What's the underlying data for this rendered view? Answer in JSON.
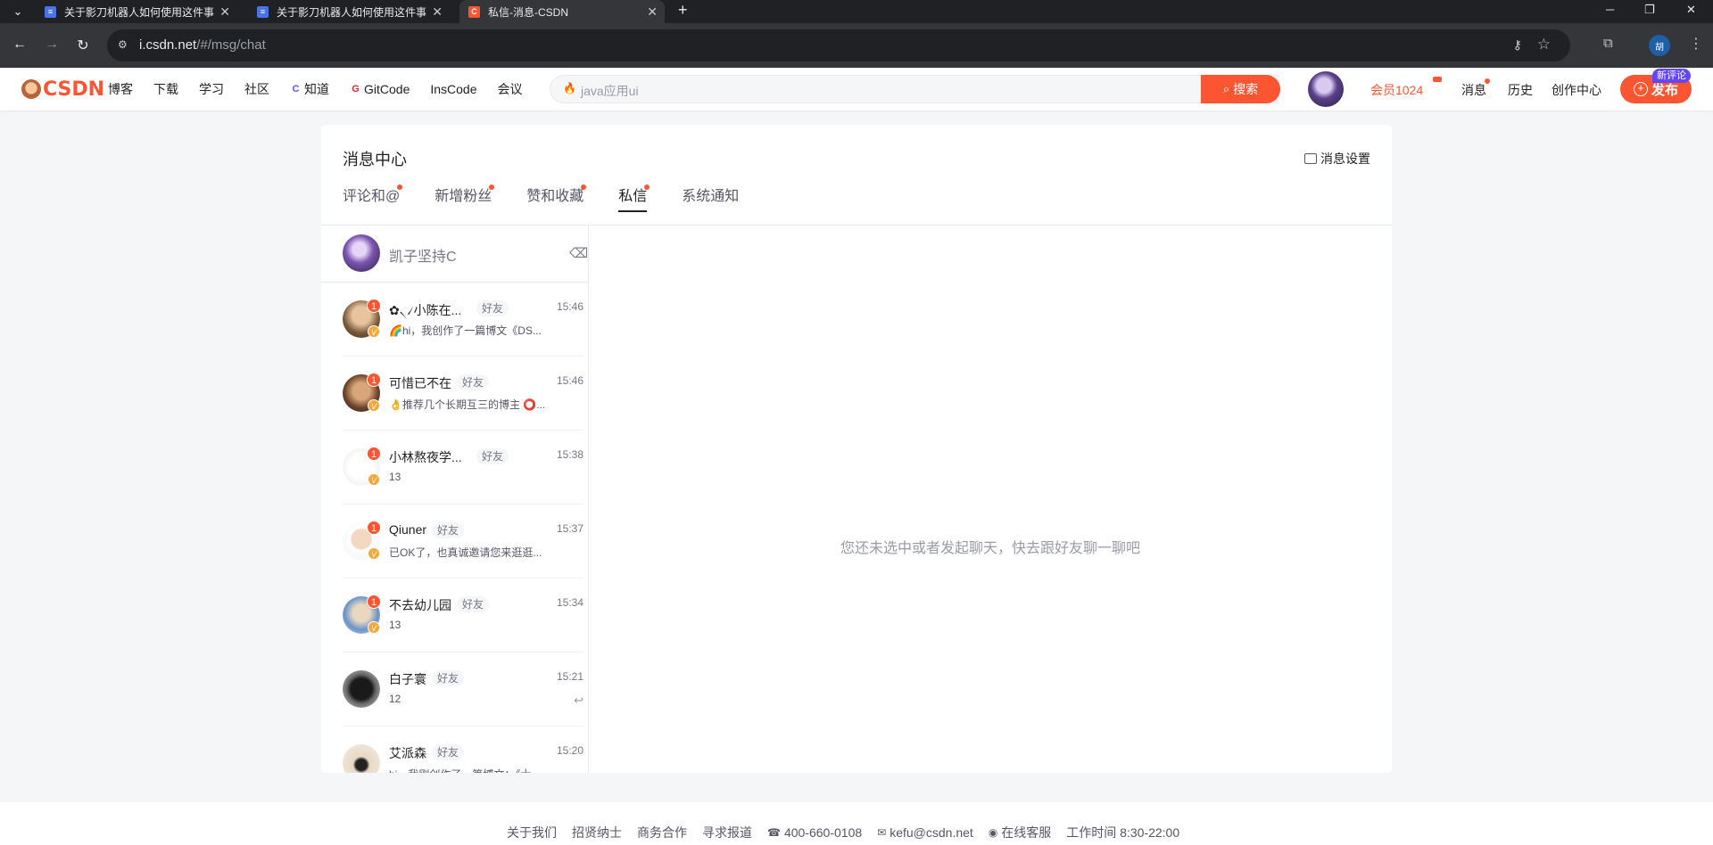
{
  "browser": {
    "tabs": [
      {
        "title": "关于影刀机器人如何使用这件事"
      },
      {
        "title": "关于影刀机器人如何使用这件事"
      },
      {
        "title": "私信-消息-CSDN"
      }
    ],
    "url_host": "i.csdn.net",
    "url_path": "/#/msg/chat",
    "profile_initial": "胡"
  },
  "header": {
    "logo": "CSDN",
    "nav": [
      "博客",
      "下载",
      "学习",
      "社区",
      "知道",
      "GitCode",
      "InsCode",
      "会议"
    ],
    "search_placeholder": "java应用ui",
    "search_button": "搜索",
    "vip": "会员1024",
    "messages": "消息",
    "history": "历史",
    "creator": "创作中心",
    "publish": "发布",
    "new_comment": "新评论"
  },
  "msg_center": {
    "title": "消息中心",
    "settings": "消息设置",
    "tabs": [
      "评论和@",
      "新增粉丝",
      "赞和收藏",
      "私信",
      "系统通知"
    ],
    "active_tab": "私信",
    "me": "凯子坚持C",
    "empty_text": "您还未选中或者发起聊天，快去跟好友聊一聊吧",
    "conversations": [
      {
        "name": "✿৲৴小陈在...",
        "tag": "好友",
        "time": "15:46",
        "preview": "🌈hi，我创作了一篇博文《DS...",
        "unread": "1",
        "v": "V"
      },
      {
        "name": "可惜已不在",
        "tag": "好友",
        "time": "15:46",
        "preview": "👌推荐几个长期互三的博主 ⭕...",
        "unread": "1",
        "v": "V"
      },
      {
        "name": "小林熬夜学...",
        "tag": "好友",
        "time": "15:38",
        "preview": "13",
        "unread": "1",
        "v": "V"
      },
      {
        "name": "Qiuner",
        "tag": "好友",
        "time": "15:37",
        "preview": "已OK了，也真诚邀请您来逛逛...",
        "unread": "1",
        "v": "V"
      },
      {
        "name": "不去幼儿园",
        "tag": "好友",
        "time": "15:34",
        "preview": "13",
        "unread": "1",
        "v": "V"
      },
      {
        "name": "白子寰",
        "tag": "好友",
        "time": "15:21",
        "preview": "12",
        "unread": "",
        "v": ""
      },
      {
        "name": "艾派森",
        "tag": "好友",
        "time": "15:20",
        "preview": "hi，我刚创作了一篇博文：《大...",
        "unread": "",
        "v": ""
      }
    ]
  },
  "footer": {
    "links": [
      "关于我们",
      "招贤纳士",
      "商务合作",
      "寻求报道",
      "400-660-0108",
      "kefu@csdn.net",
      "在线客服",
      "工作时间 8:30-22:00"
    ]
  },
  "colors": {
    "brand": "#fc5531",
    "chrome_dark": "#202124",
    "chrome_toolbar": "#35363a"
  }
}
